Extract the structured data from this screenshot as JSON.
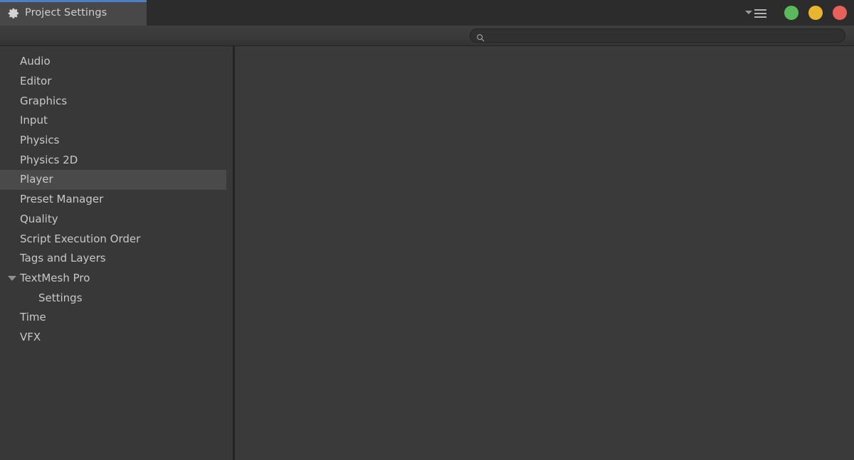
{
  "window": {
    "tab_title": "Project Settings",
    "tab_icon": "gear-icon",
    "accent_color": "#4a7fc9",
    "controls": {
      "menu_icon": "hamburger-menu-icon",
      "dropdown_icon": "chevron-down-icon",
      "minimize_color": "#5cb85c",
      "maximize_color": "#e8b52e",
      "close_color": "#e8605a"
    }
  },
  "search": {
    "icon": "search-icon",
    "value": "",
    "placeholder": ""
  },
  "sidebar": {
    "items": [
      {
        "label": "Audio",
        "depth": 0,
        "selected": false,
        "foldout": "none"
      },
      {
        "label": "Editor",
        "depth": 0,
        "selected": false,
        "foldout": "none"
      },
      {
        "label": "Graphics",
        "depth": 0,
        "selected": false,
        "foldout": "none"
      },
      {
        "label": "Input",
        "depth": 0,
        "selected": false,
        "foldout": "none"
      },
      {
        "label": "Physics",
        "depth": 0,
        "selected": false,
        "foldout": "none"
      },
      {
        "label": "Physics 2D",
        "depth": 0,
        "selected": false,
        "foldout": "none"
      },
      {
        "label": "Player",
        "depth": 0,
        "selected": true,
        "foldout": "none"
      },
      {
        "label": "Preset Manager",
        "depth": 0,
        "selected": false,
        "foldout": "none"
      },
      {
        "label": "Quality",
        "depth": 0,
        "selected": false,
        "foldout": "none"
      },
      {
        "label": "Script Execution Order",
        "depth": 0,
        "selected": false,
        "foldout": "none"
      },
      {
        "label": "Tags and Layers",
        "depth": 0,
        "selected": false,
        "foldout": "none"
      },
      {
        "label": "TextMesh Pro",
        "depth": 0,
        "selected": false,
        "foldout": "expanded"
      },
      {
        "label": "Settings",
        "depth": 1,
        "selected": false,
        "foldout": "none"
      },
      {
        "label": "Time",
        "depth": 0,
        "selected": false,
        "foldout": "none"
      },
      {
        "label": "VFX",
        "depth": 0,
        "selected": false,
        "foldout": "none"
      }
    ]
  },
  "main": {
    "body_text": ""
  }
}
